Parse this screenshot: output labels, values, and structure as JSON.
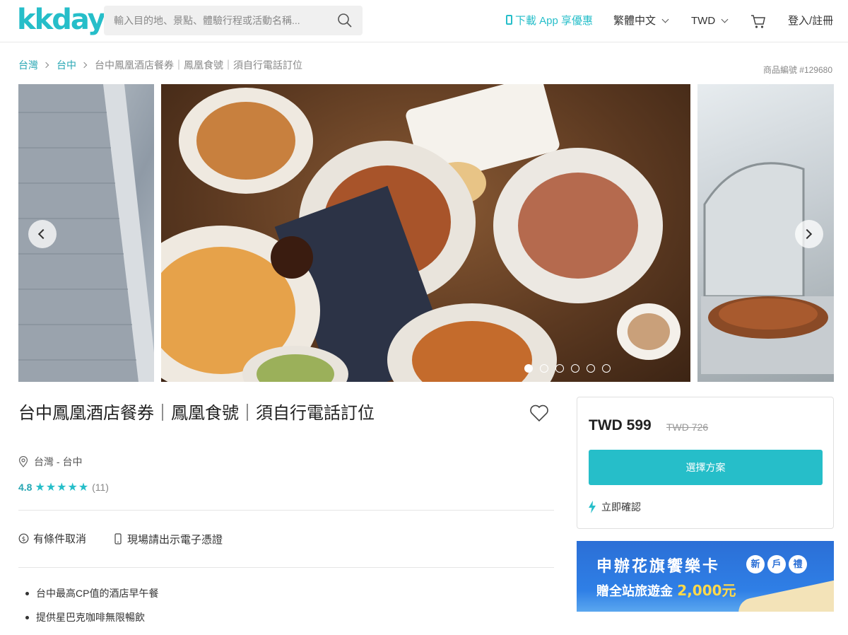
{
  "header": {
    "logo": "kkday",
    "search_placeholder": "輸入目的地、景點、體驗行程或活動名稱...",
    "app_link": "下載 App 享優惠",
    "language": "繁體中文",
    "currency": "TWD",
    "login": "登入/註冊",
    "icons": [
      "search-icon",
      "phone-icon",
      "chevron-down-icon",
      "cart-icon"
    ]
  },
  "breadcrumb": {
    "items": [
      "台灣",
      "台中"
    ],
    "current": "台中鳳凰酒店餐券｜鳳凰食號｜須自行電話訂位"
  },
  "product_number": "商品編號 #129680",
  "gallery": {
    "slide_count": 6,
    "active_index": 0,
    "slides": [
      "hotel-building-image",
      "buffet-food-image",
      "buffet-chafing-dish-image"
    ]
  },
  "product": {
    "title": "台中鳳凰酒店餐券｜鳳凰食號｜須自行電話訂位",
    "location": "台灣 - 台中",
    "rating": "4.8",
    "stars": "★★★★★",
    "review_count": "(11)",
    "features": [
      "有條件取消",
      "現場請出示電子憑證"
    ],
    "highlights": [
      "台中最高CP值的酒店早午餐",
      "提供星巴克咖啡無限暢飲"
    ]
  },
  "booking": {
    "price": "TWD 599",
    "original_price": "TWD 726",
    "select_button": "選擇方案",
    "instant_confirm": "立即確認"
  },
  "banner": {
    "line1": "申辦花旗饗樂卡",
    "badges": [
      "新",
      "戶",
      "禮"
    ],
    "line2_prefix": "贈全站旅遊金",
    "line2_amount": "2,000元"
  },
  "colors": {
    "brand": "#26bec9",
    "link": "#26a6b3",
    "banner": "#2b6fd6",
    "banner_amount": "#ffd94a"
  }
}
